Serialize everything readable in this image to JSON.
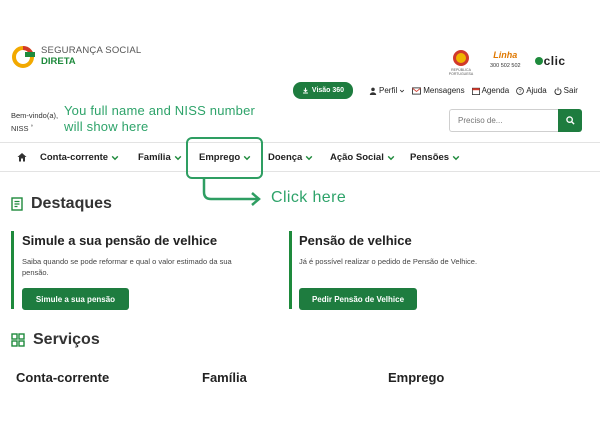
{
  "brand": {
    "line1": "SEGURANÇA SOCIAL",
    "line2": "DIRETA",
    "accent": "#1e8a3c",
    "mark_colors": [
      "#f2a900",
      "#d1392b",
      "#1e8a3c"
    ]
  },
  "partners": {
    "republica_caption": "REPÚBLICA PORTUGUESA",
    "linha_name": "Linha",
    "linha_number": "300 502 502",
    "eclic": "clic"
  },
  "topnav": {
    "visao_label": "Visão 360",
    "items": [
      {
        "label": "Perfil",
        "icon": "user-icon"
      },
      {
        "label": "Mensagens",
        "icon": "mail-icon"
      },
      {
        "label": "Agenda",
        "icon": "calendar-icon"
      },
      {
        "label": "Ajuda",
        "icon": "help-icon"
      },
      {
        "label": "Sair",
        "icon": "power-icon"
      }
    ]
  },
  "welcome": {
    "line1": "Bem-vindo(a),",
    "line2": "NISS"
  },
  "annotation": {
    "note_line1": "You full name and NISS number",
    "note_line2": "will show here",
    "click_text": "Click here",
    "color": "#2ea36a"
  },
  "search": {
    "placeholder": "Preciso de..."
  },
  "mainnav": {
    "items": [
      "Conta-corrente",
      "Família",
      "Emprego",
      "Doença",
      "Ação Social",
      "Pensões"
    ]
  },
  "destaques": {
    "title": "Destaques",
    "cards": [
      {
        "title": "Simule a sua pensão de velhice",
        "text_line1": "Saiba quando se pode reformar e qual o valor estimado da sua",
        "text_line2": "pensão.",
        "button": "Simule a sua pensão"
      },
      {
        "title": "Pensão de velhice",
        "text_line1": "Já é possível realizar o pedido de Pensão de Velhice.",
        "text_line2": "",
        "button": "Pedir Pensão de Velhice"
      }
    ]
  },
  "servicos": {
    "title": "Serviços",
    "columns": [
      "Conta-corrente",
      "Família",
      "Emprego"
    ]
  },
  "colors": {
    "primary_green": "#1e7c3f",
    "text": "#222222"
  }
}
